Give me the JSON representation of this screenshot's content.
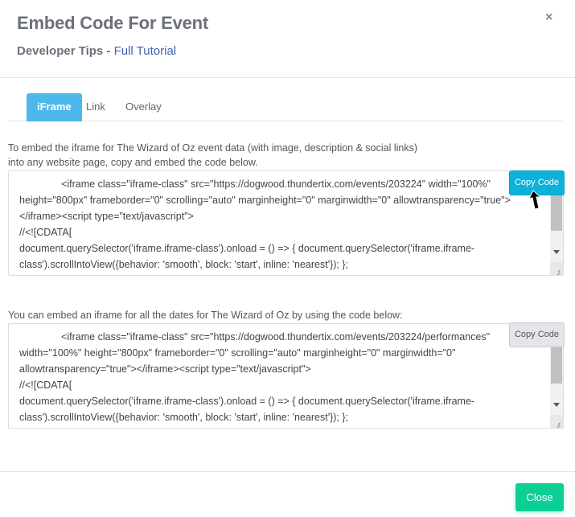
{
  "header": {
    "title": "Embed Code For Event",
    "subtitle_prefix": "Developer Tips - ",
    "subtitle_link": "Full Tutorial",
    "close_icon": "×"
  },
  "tabs": [
    {
      "label": "iFrame",
      "active": true
    },
    {
      "label": "Link",
      "active": false
    },
    {
      "label": "Overlay",
      "active": false
    }
  ],
  "sections": [
    {
      "description_line1": "To embed the iframe for The Wizard of Oz event data (with image, description & social links)",
      "description_line2": "into any website page, copy and embed the code below.",
      "code": "               <iframe class=\"iframe-class\" src=\"https://dogwood.thundertix.com/events/203224\" width=\"100%\" height=\"800px\" frameborder=\"0\" scrolling=\"auto\" marginheight=\"0\" marginwidth=\"0\" allowtransparency=\"true\">\n</iframe><script type=\"text/javascript\">\n//<![CDATA[\ndocument.querySelector('iframe.iframe-class').onload = () => { document.querySelector('iframe.iframe-class').scrollIntoView({behavior: 'smooth', block: 'start', inline: 'nearest'}); };\n//]]>",
      "copy_label": "Copy Code",
      "copy_state": "hover"
    },
    {
      "description_line1": "You can embed an iframe for all the dates for The Wizard of Oz by using the code below:",
      "code": "               <iframe class=\"iframe-class\" src=\"https://dogwood.thundertix.com/events/203224/performances\" width=\"100%\" height=\"800px\" frameborder=\"0\" scrolling=\"auto\" marginheight=\"0\" marginwidth=\"0\" allowtransparency=\"true\"></iframe><script type=\"text/javascript\">\n//<![CDATA[\ndocument.querySelector('iframe.iframe-class').onload = () => { document.querySelector('iframe.iframe-class').scrollIntoView({behavior: 'smooth', block: 'start', inline: 'nearest'}); };\n//]]>",
      "copy_label": "Copy Code",
      "copy_state": "default"
    }
  ],
  "footer": {
    "close_label": "Close"
  },
  "colors": {
    "tab_active": "#4cb8ec",
    "copy_active": "#0cb2d9",
    "close_button": "#0ccf96",
    "link": "#3d60b5"
  }
}
